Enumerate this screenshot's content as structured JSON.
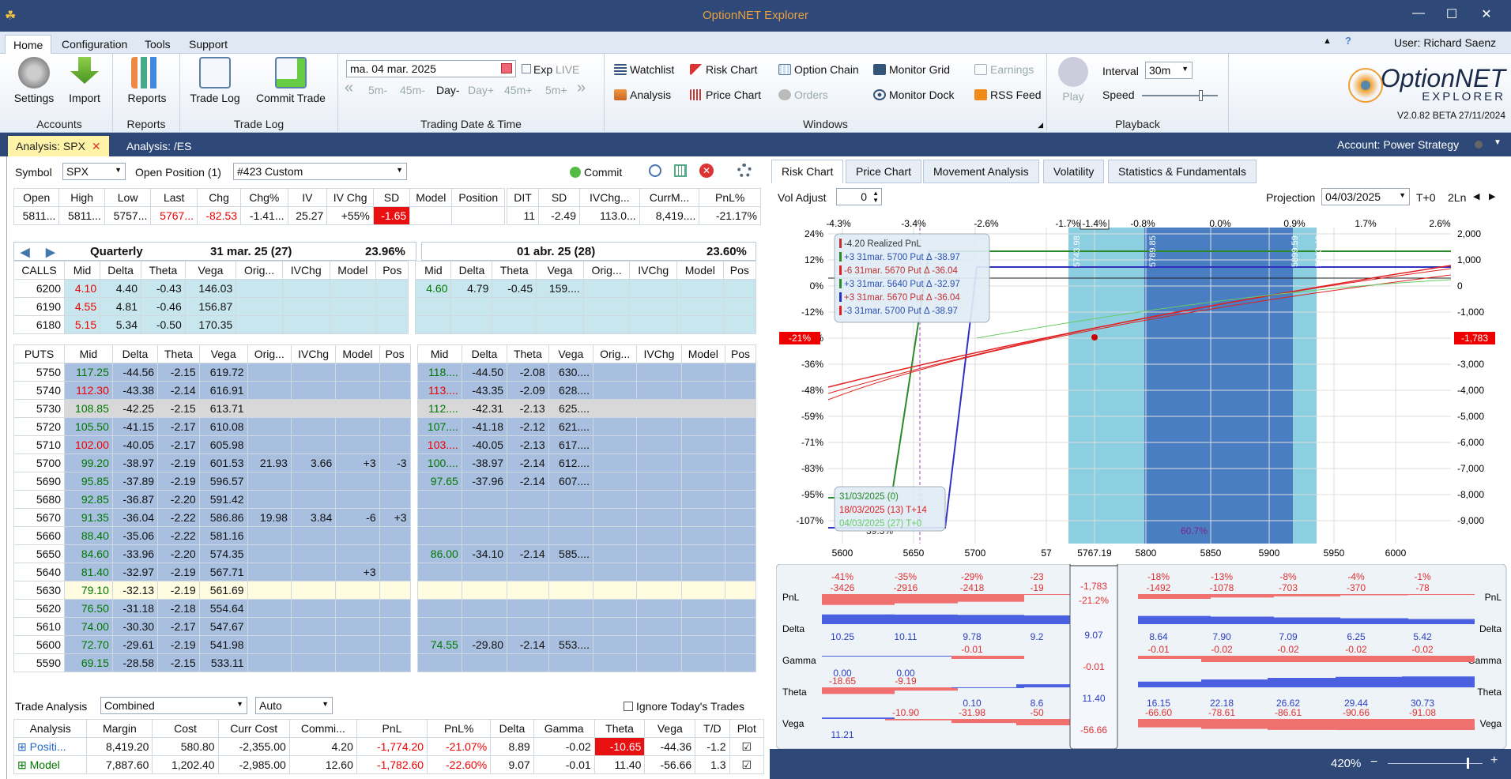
{
  "app": {
    "title": "OptionNET Explorer",
    "user": "User: Richard Saenz",
    "logo_line1": "OptionNET",
    "logo_line2": "EXPLORER",
    "version": "V2.0.82 BETA 27/11/2024"
  },
  "ribbon_tabs": [
    "Home",
    "Configuration",
    "Tools",
    "Support"
  ],
  "ribbon": {
    "accounts": {
      "label": "Accounts",
      "settings": "Settings",
      "import": "Import"
    },
    "reports": {
      "label": "Reports",
      "reports": "Reports"
    },
    "tradelog": {
      "label": "Trade Log",
      "trade_log": "Trade Log",
      "commit_trade": "Commit Trade"
    },
    "date": {
      "label": "Trading Date & Time",
      "value": "ma. 04 mar. 2025",
      "exp": "Exp",
      "live": "LIVE",
      "steps": [
        "5m-",
        "45m-",
        "Day-",
        "Day+",
        "45m+",
        "5m+"
      ]
    },
    "windows": {
      "label": "Windows",
      "items": [
        "Watchlist",
        "Risk Chart",
        "Option Chain",
        "Monitor Grid",
        "Earnings",
        "Analysis",
        "Price Chart",
        "Orders",
        "Monitor Dock",
        "RSS Feed"
      ]
    },
    "playback": {
      "label": "Playback",
      "play": "Play",
      "interval_label": "Interval",
      "interval": "30m",
      "speed": "Speed"
    }
  },
  "doc_tabs": [
    "Analysis: SPX",
    "Analysis: /ES"
  ],
  "account": "Account: Power Strategy",
  "symbol": {
    "label": "Symbol",
    "value": "SPX",
    "open_pos_label": "Open Position (1)",
    "open_pos_value": "#423 Custom",
    "commit": "Commit"
  },
  "quote": {
    "headers": [
      "Open",
      "High",
      "Low",
      "Last",
      "Chg",
      "Chg%",
      "IV",
      "IV Chg",
      "SD",
      "Model",
      "Position"
    ],
    "values": [
      "5811...",
      "5811...",
      "5757...",
      "5767...",
      "-82.53",
      "-1.41...",
      "25.27",
      "+55%",
      "-1.65",
      "",
      ""
    ]
  },
  "quote2": {
    "headers": [
      "DIT",
      "SD",
      "IVChg...",
      "CurrM...",
      "PnL%"
    ],
    "values": [
      "11",
      "-2.49",
      "113.0...",
      "8,419....",
      "-21.17%"
    ]
  },
  "exp1": {
    "name": "Quarterly",
    "date": "31 mar. 25 (27)",
    "iv": "23.96%"
  },
  "exp2": {
    "date": "01 abr. 25 (28)",
    "iv": "23.60%"
  },
  "cols1": [
    "Mid",
    "Delta",
    "Theta",
    "Vega",
    "Orig...",
    "IVChg",
    "Model",
    "Pos"
  ],
  "cols2": [
    "Mid",
    "Delta",
    "Theta",
    "Vega",
    "Orig...",
    "IVChg",
    "Model",
    "Pos"
  ],
  "calls_label": "CALLS",
  "puts_label": "PUTS",
  "calls": [
    [
      "6200",
      "4.10",
      "4.40",
      "-0.43",
      "146.03",
      "4.60",
      "4.79",
      "-0.45",
      "159...."
    ],
    [
      "6190",
      "4.55",
      "4.81",
      "-0.46",
      "156.87",
      "",
      "",
      "",
      ""
    ],
    [
      "6180",
      "5.15",
      "5.34",
      "-0.50",
      "170.35",
      "",
      "",
      "",
      ""
    ]
  ],
  "puts": [
    [
      "5750",
      "117.25",
      "-44.56",
      "-2.15",
      "619.72",
      "",
      "",
      "",
      "",
      "118....",
      "-44.50",
      "-2.08",
      "630...."
    ],
    [
      "5740",
      "112.30",
      "-43.38",
      "-2.14",
      "616.91",
      "",
      "",
      "",
      "",
      "113....",
      "-43.35",
      "-2.09",
      "628...."
    ],
    [
      "5730",
      "108.85",
      "-42.25",
      "-2.15",
      "613.71",
      "",
      "",
      "",
      "",
      "112....",
      "-42.31",
      "-2.13",
      "625...."
    ],
    [
      "5720",
      "105.50",
      "-41.15",
      "-2.17",
      "610.08",
      "",
      "",
      "",
      "",
      "107....",
      "-41.18",
      "-2.12",
      "621...."
    ],
    [
      "5710",
      "102.00",
      "-40.05",
      "-2.17",
      "605.98",
      "",
      "",
      "",
      "",
      "103....",
      "-40.05",
      "-2.13",
      "617...."
    ],
    [
      "5700",
      "99.20",
      "-38.97",
      "-2.19",
      "601.53",
      "21.93",
      "3.66",
      "+3",
      "-3",
      "100....",
      "-38.97",
      "-2.14",
      "612...."
    ],
    [
      "5690",
      "95.85",
      "-37.89",
      "-2.19",
      "596.57",
      "",
      "",
      "",
      "",
      "97.65",
      "-37.96",
      "-2.14",
      "607...."
    ],
    [
      "5680",
      "92.85",
      "-36.87",
      "-2.20",
      "591.42",
      "",
      "",
      "",
      "",
      "",
      "",
      "",
      ""
    ],
    [
      "5670",
      "91.35",
      "-36.04",
      "-2.22",
      "586.86",
      "19.98",
      "3.84",
      "-6",
      "+3",
      "",
      "",
      "",
      ""
    ],
    [
      "5660",
      "88.40",
      "-35.06",
      "-2.22",
      "581.16",
      "",
      "",
      "",
      "",
      "",
      "",
      "",
      ""
    ],
    [
      "5650",
      "84.60",
      "-33.96",
      "-2.20",
      "574.35",
      "",
      "",
      "",
      "",
      "86.00",
      "-34.10",
      "-2.14",
      "585...."
    ],
    [
      "5640",
      "81.40",
      "-32.97",
      "-2.19",
      "567.71",
      "",
      "",
      "+3",
      "",
      "",
      "",
      "",
      ""
    ],
    [
      "5630",
      "79.10",
      "-32.13",
      "-2.19",
      "561.69",
      "",
      "",
      "",
      "",
      "",
      "",
      "",
      ""
    ],
    [
      "5620",
      "76.50",
      "-31.18",
      "-2.18",
      "554.64",
      "",
      "",
      "",
      "",
      "",
      "",
      "",
      ""
    ],
    [
      "5610",
      "74.00",
      "-30.30",
      "-2.17",
      "547.67",
      "",
      "",
      "",
      "",
      "",
      "",
      "",
      ""
    ],
    [
      "5600",
      "72.70",
      "-29.61",
      "-2.19",
      "541.98",
      "",
      "",
      "",
      "",
      "74.55",
      "-29.80",
      "-2.14",
      "553...."
    ],
    [
      "5590",
      "69.15",
      "-28.58",
      "-2.15",
      "533.11",
      "",
      "",
      "",
      "",
      "",
      "",
      "",
      ""
    ]
  ],
  "trade_analysis": {
    "label": "Trade Analysis",
    "mode": "Combined",
    "auto": "Auto",
    "ignore": "Ignore Today's Trades",
    "headers": [
      "Analysis",
      "Margin",
      "Cost",
      "Curr Cost",
      "Commi...",
      "PnL",
      "PnL%",
      "Delta",
      "Gamma",
      "Theta",
      "Vega",
      "T/D",
      "Plot"
    ],
    "rows": [
      [
        "Positi...",
        "8,419.20",
        "580.80",
        "-2,355.00",
        "4.20",
        "-1,774.20",
        "-21.07%",
        "8.89",
        "-0.02",
        "-10.65",
        "-44.36",
        "-1.2"
      ],
      [
        "Model",
        "7,887.60",
        "1,202.40",
        "-2,985.00",
        "12.60",
        "-1,782.60",
        "-22.60%",
        "9.07",
        "-0.01",
        "11.40",
        "-56.66",
        "1.3"
      ]
    ]
  },
  "chart_tabs": [
    "Risk Chart",
    "Price Chart",
    "Movement Analysis",
    "Volatility",
    "Statistics & Fundamentals"
  ],
  "vol_adjust": {
    "label": "Vol Adjust",
    "value": "0"
  },
  "projection": {
    "label": "Projection",
    "date": "04/03/2025",
    "t0": "T+0",
    "ln": "2Ln"
  },
  "chart_data": {
    "type": "line",
    "x_ticks": [
      "5600",
      "5650",
      "5700",
      "57",
      "5767.19",
      "5800",
      "5850",
      "5900",
      "5950",
      "6000"
    ],
    "top_pct_ticks": [
      "-4.3%",
      "-3.4%",
      "-2.6%",
      "-1.7%",
      "-1.4%",
      "-0.8%",
      "0.0%",
      "0.9%",
      "1.7%",
      "2.6%"
    ],
    "y_left": [
      "24%",
      "12%",
      "0%",
      "-12%",
      "-24%",
      "-36%",
      "-48%",
      "-59%",
      "-71%",
      "-83%",
      "-95%",
      "-107%"
    ],
    "y_right": [
      "2,000",
      "1,000",
      "0",
      "-1,000",
      "-2,000",
      "-3,000",
      "-4,000",
      "-5,000",
      "-6,000",
      "-7,000",
      "-8,000",
      "-9,000"
    ],
    "left_marker": "-21%",
    "right_marker": "-1,783",
    "band_labels": [
      "5743.98",
      "5789.85",
      "5899.59",
      "5943.46"
    ],
    "vline_label": "5616.26",
    "pct_labels": [
      "39.3%",
      "60.7%"
    ],
    "legend": [
      "-4.20 Realized PnL",
      "+3 31mar. 5700 Put Δ  -38.97",
      "-6 31mar. 5670 Put Δ  -36.04",
      "+3 31mar. 5640 Put Δ  -32.97",
      "+3 31mar. 5670 Put Δ  -36.04",
      "-3 31mar. 5700 Put Δ  -38.97"
    ],
    "date_legend": [
      "31/03/2025 (0)",
      "18/03/2025 (13) T+14",
      "04/03/2025 (27) T+0"
    ]
  },
  "greeks": {
    "rows": [
      "PnL",
      "Delta",
      "Gamma",
      "Theta",
      "Vega"
    ],
    "pnl_pct": [
      "-41%",
      "-35%",
      "-29%",
      "-23",
      "",
      "-18%",
      "-13%",
      "-8%",
      "-4%",
      "-1%"
    ],
    "pnl": [
      "-3426",
      "-2916",
      "-2418",
      "-19",
      "",
      "-1492",
      "-1078",
      "-703",
      "-370",
      "-78"
    ],
    "delta": [
      "10.25",
      "10.11",
      "9.78",
      "9.2",
      "",
      "8.64",
      "7.90",
      "7.09",
      "6.25",
      "5.42"
    ],
    "gamma": [
      "0.00",
      "0.00",
      "-0.01",
      "",
      "",
      "-0.01",
      "-0.02",
      "-0.02",
      "-0.02",
      "-0.02"
    ],
    "theta": [
      "-18.65",
      "-9.19",
      "0.10",
      "8.6",
      "",
      "16.15",
      "22.18",
      "26.62",
      "29.44",
      "30.73"
    ],
    "vega": [
      "11.21",
      "-10.90",
      "-31.98",
      "-50",
      "",
      "-66.60",
      "-78.61",
      "-86.61",
      "-90.66",
      "-91.08"
    ],
    "center": {
      "pnl": "-1,783",
      "pnl_pct": "-21.2%",
      "delta": "9.07",
      "gamma": "-0.01",
      "theta": "11.40",
      "vega": "-56.66"
    }
  },
  "zoom": "420%"
}
